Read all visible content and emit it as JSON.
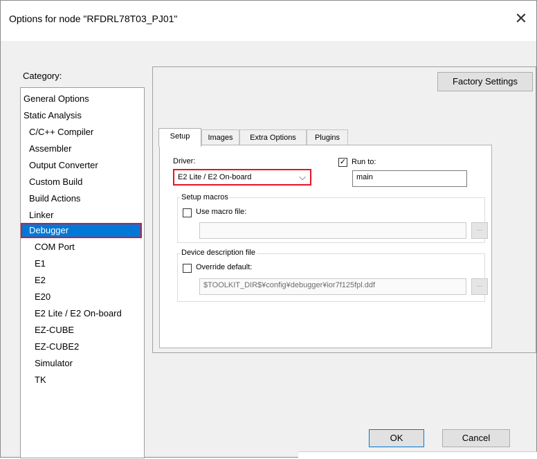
{
  "window": {
    "title": "Options for node \"RFDRL78T03_PJ01\"",
    "close_glyph": "✕"
  },
  "category": {
    "label": "Category:",
    "items": [
      "General Options",
      "Static Analysis",
      "C/C++ Compiler",
      "Assembler",
      "Output Converter",
      "Custom Build",
      "Build Actions",
      "Linker",
      "Debugger",
      "COM Port",
      "E1",
      "E2",
      "E20",
      "E2 Lite / E2 On-board",
      "EZ-CUBE",
      "EZ-CUBE2",
      "Simulator",
      "TK"
    ],
    "selected": "Debugger"
  },
  "factory_settings_label": "Factory Settings",
  "tabs": [
    "Setup",
    "Images",
    "Extra Options",
    "Plugins"
  ],
  "active_tab": "Setup",
  "setup": {
    "driver_label": "Driver:",
    "driver_value": "E2 Lite / E2 On-board",
    "run_to_label": "Run to:",
    "run_to_checked": true,
    "run_to_value": "main",
    "setup_macros_title": "Setup macros",
    "use_macro_label": "Use macro file:",
    "use_macro_checked": false,
    "macro_file_value": "",
    "device_desc_title": "Device description file",
    "override_label": "Override default:",
    "override_checked": false,
    "ddf_value": "$TOOLKIT_DIR$¥config¥debugger¥ior7f125fpl.ddf",
    "browse_glyph": "..."
  },
  "ok_label": "OK",
  "cancel_label": "Cancel",
  "colors": {
    "selection": "#0078d7",
    "highlight_border": "#e81123"
  }
}
